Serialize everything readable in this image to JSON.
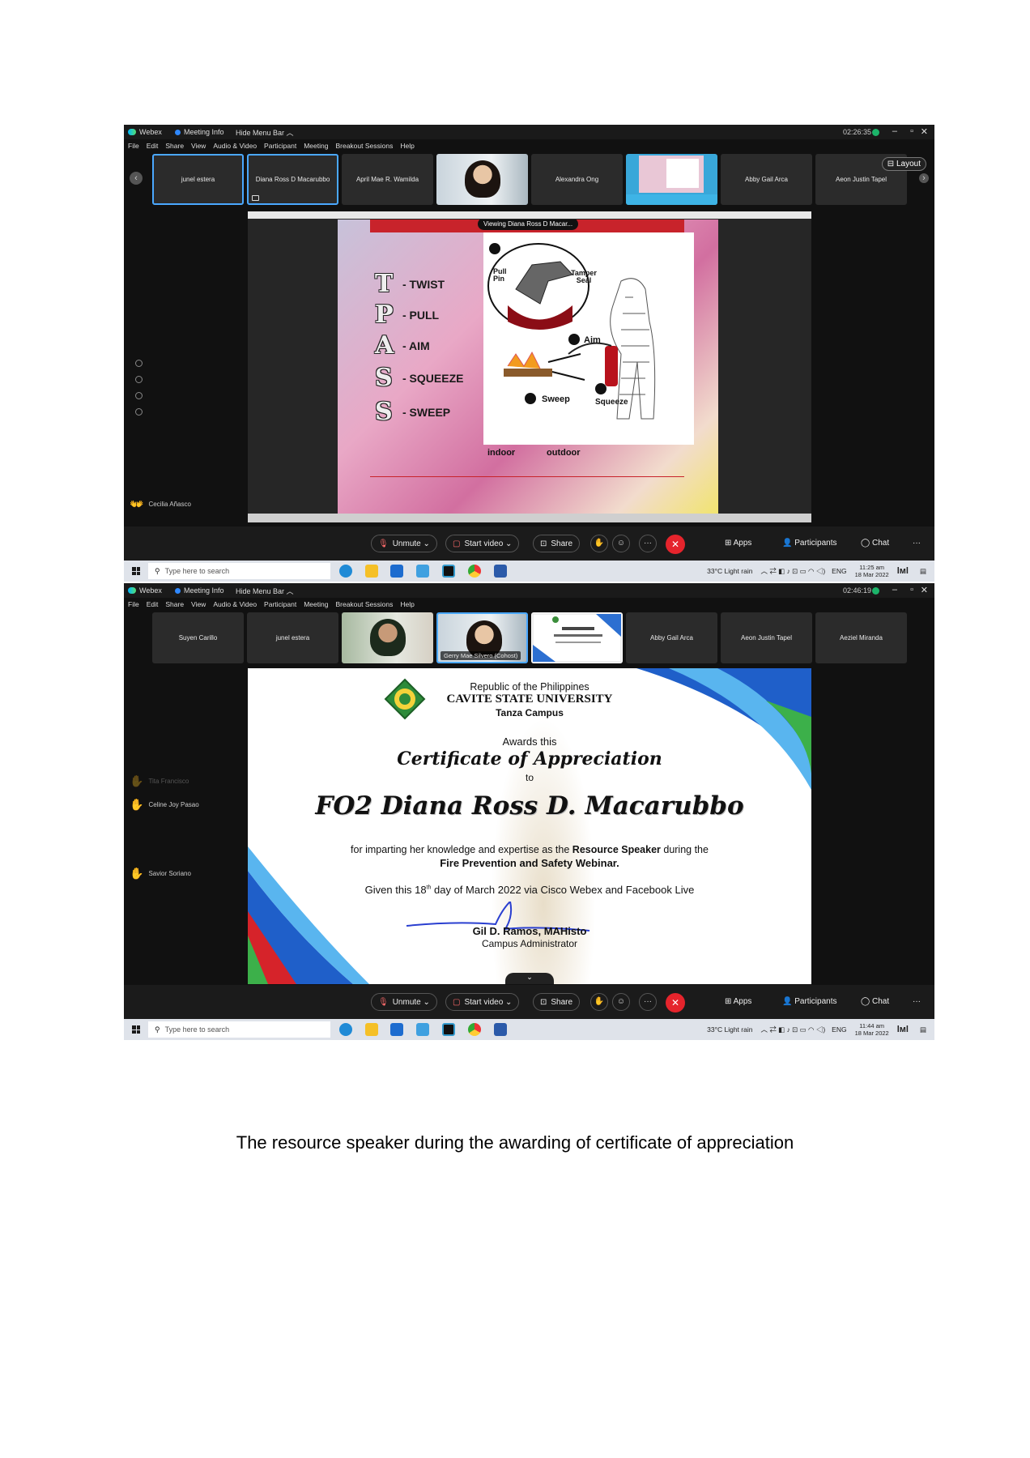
{
  "window": {
    "app_name": "Webex",
    "meeting_info": "Meeting Info",
    "hide_menu_bar": "Hide Menu Bar",
    "menu": [
      "File",
      "Edit",
      "Share",
      "View",
      "Audio & Video",
      "Participant",
      "Meeting",
      "Breakout Sessions",
      "Help"
    ]
  },
  "shot1": {
    "clock": "02:26:35",
    "participants": [
      "junel estera",
      "Diana Ross D Macarubbo",
      "April Mae R. Wamilda",
      "",
      "Alexandra Ong",
      "",
      "Abby Gail Arca",
      "Aeon Justin Tapel"
    ],
    "layout_label": "Layout",
    "viewing_label": "Viewing Diana Ross D Macar...",
    "slide": {
      "letters": [
        "T",
        "P",
        "A",
        "S",
        "S"
      ],
      "words": [
        "- TWIST",
        "- PULL",
        "- AIM",
        "- SQUEEZE",
        "- SWEEP"
      ],
      "labels": {
        "pull_pin": "Pull Pin",
        "tamper_seal": "Tamper Seal",
        "aim": "Aim",
        "sweep": "Sweep",
        "squeeze": "Squeeze"
      },
      "captions": [
        "indoor",
        "outdoor"
      ]
    },
    "raised_hand_person": "Cecilia Añasco",
    "time": "11:25 am",
    "date": "18 Mar 2022"
  },
  "shot2": {
    "clock": "02:46:19",
    "participants": [
      "Suyen Carillo",
      "junel estera",
      "",
      "Gerry Mae Silvero (Cohost)",
      "",
      "Abby Gail Arca",
      "Aeon Justin Tapel",
      "Aeziel Miranda"
    ],
    "certificate": {
      "line1": "Republic of the Philippines",
      "line2": "CAVITE STATE UNIVERSITY",
      "line3": "Tanza Campus",
      "awards": "Awards this",
      "title": "Certificate of Appreciation",
      "to": "to",
      "recipient": "FO2 Diana Ross D. Macarubbo",
      "body_a": "for imparting her knowledge and expertise as the ",
      "body_b": "Resource Speaker",
      "body_c": " during the",
      "body_d": "Fire Prevention and Safety Webinar.",
      "given_a": "Given this 18",
      "given_sup": "th",
      "given_b": " day of March 2022 via Cisco Webex and Facebook Live",
      "signer": "Gil D. Ramos, MAHisto",
      "signer_title": "Campus Administrator"
    },
    "raised_hands": [
      "Tita Francisco",
      "Celine Joy Pasao",
      "Savior Soriano"
    ],
    "time": "11:44 am",
    "date": "18 Mar 2022"
  },
  "controls": {
    "unmute": "Unmute",
    "start_video": "Start video",
    "share": "Share",
    "more": "···",
    "apps": "Apps",
    "participants": "Participants",
    "chat": "Chat"
  },
  "taskbar": {
    "search_placeholder": "Type here to search",
    "weather": "33°C  Light rain",
    "lang": "ENG"
  },
  "caption": "The resource speaker during the awarding of certificate of appreciation",
  "colors": {
    "webex_bg": "#111111",
    "active_tile": "#4aa8ff",
    "end_call": "#e5242c",
    "slide_red": "#c8232b"
  }
}
